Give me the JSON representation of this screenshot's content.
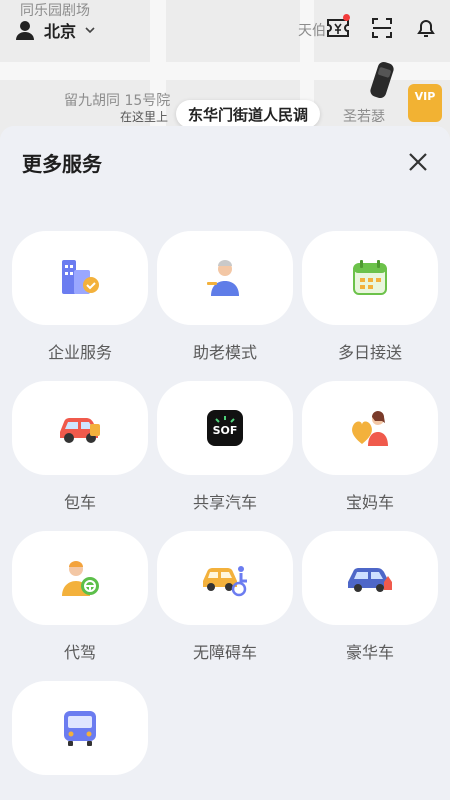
{
  "map": {
    "labels": [
      "同乐园剧场",
      "天伯",
      "留九胡同 15号院",
      "圣若瑟"
    ],
    "location_hint": "在这里上",
    "location_pill": "东华门街道人民调",
    "vip": "VIP"
  },
  "header": {
    "city": "北京",
    "icons": [
      "coupon-icon",
      "scan-icon",
      "bell-icon"
    ]
  },
  "sheet": {
    "title": "更多服务",
    "services": [
      {
        "label": "企业服务",
        "icon": "enterprise-icon"
      },
      {
        "label": "助老模式",
        "icon": "elderly-mode-icon"
      },
      {
        "label": "多日接送",
        "icon": "calendar-icon"
      },
      {
        "label": "包车",
        "icon": "charter-car-icon"
      },
      {
        "label": "共享汽车",
        "icon": "car-sharing-icon"
      },
      {
        "label": "宝妈车",
        "icon": "mom-car-icon"
      },
      {
        "label": "代驾",
        "icon": "designated-driver-icon"
      },
      {
        "label": "无障碍车",
        "icon": "accessible-car-icon"
      },
      {
        "label": "豪华车",
        "icon": "luxury-car-icon"
      },
      {
        "label": "",
        "icon": "bus-icon"
      }
    ]
  },
  "colors": {
    "accent": "#f2b233",
    "sheet_bg": "#eef0f5"
  }
}
